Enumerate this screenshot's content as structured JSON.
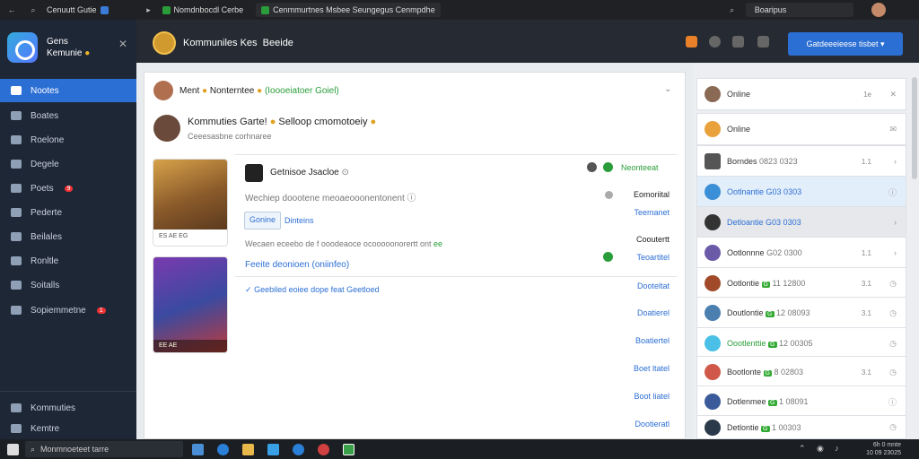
{
  "browser": {
    "tabs": [
      {
        "title": "Cenuutt Gutie"
      },
      {
        "title": "Nomdnbocdl Cerbe"
      },
      {
        "title": "Cenmmurtnes Msbee Seungegus Cenmpdhe"
      }
    ],
    "profile_label": "Boaripus"
  },
  "sidebar": {
    "brand_line1": "Gens",
    "brand_line2": "Kemunie",
    "items": [
      {
        "label": "Nootes",
        "active": true
      },
      {
        "label": "Boates"
      },
      {
        "label": "Roelone"
      },
      {
        "label": "Degele"
      },
      {
        "label": "Poets",
        "badge": "9"
      },
      {
        "label": "Pederte"
      },
      {
        "label": "Beilales"
      },
      {
        "label": "Ronltle"
      },
      {
        "label": "Soitalls"
      },
      {
        "label": "Sopiemmetne",
        "badge": "1"
      }
    ],
    "footer": [
      "Kommuties",
      "Kemtre"
    ]
  },
  "header": {
    "title": "Kommuniles  Kes",
    "title2": "Beeide",
    "action_button": "Gatdeeeieese tisbet"
  },
  "post": {
    "author_line": "Ment",
    "author_tag": "Nonterntee",
    "status_green": "(Ioooeiatoer Goiel)",
    "headline": "Kommuties Garte!",
    "headline2": "Selloop cmomotoeiy",
    "subtext": "Ceeesasbne corhnaree"
  },
  "detail": {
    "name": "Getnisoe Jsacloe",
    "desc": "Wechiep doootene meoaeooonentonent",
    "tab_active": "Gonine",
    "tab_other": "Dinteins",
    "body": "Wecaen eceebo de f ooodeaoce ocooooonorertt ont",
    "body_tag": "ee",
    "link": "Feeite deonioen (oniinfeo)",
    "check_text": "Geebiled eoiee dope feat Geetloed",
    "status_right": "Neonteeat",
    "label1": "Eomoriital",
    "link1": "Teemanet",
    "label2": "Cooutertt",
    "link2": "Teoartitel",
    "links": [
      "Dooteltat",
      "Doatierel",
      "Boatiertel",
      "Boet ltatel",
      "Boot liatel",
      "Dootieratl"
    ],
    "game1_caption": "ES AE EG",
    "game2_caption": "EE AE"
  },
  "panel": {
    "items": [
      {
        "name": "Online",
        "meta": "1e",
        "color": "#8a6a55"
      },
      {
        "name": "Online",
        "meta": "3e",
        "color": "#e9a23b"
      },
      {
        "name": "Borndes",
        "meta2": "0823 0323",
        "meta": "1.1",
        "color": "#555"
      },
      {
        "name": "Ootlnantie",
        "meta2": "G03 0303",
        "meta": "",
        "color": "#3a8fd6",
        "selected": true
      },
      {
        "name": "Detloantie",
        "meta2": "G03 0303",
        "meta": "",
        "color": "#333",
        "dark": true
      },
      {
        "name": "Ootlonnne",
        "meta2": "G02 0300",
        "meta": "1.1",
        "color": "#6a5aa8"
      },
      {
        "name": "Ootlontie",
        "meta2": "11 12800",
        "meta": "3.1",
        "color": "#a04a2a",
        "tag": "G"
      },
      {
        "name": "Doutlontie",
        "meta2": "12 08093",
        "meta": "3.1",
        "color": "#4a7fb0",
        "tag": "G"
      },
      {
        "name": "Oootlenttie",
        "meta2": "12 00305",
        "meta": "",
        "color": "#4ac0e6",
        "tag": "G"
      },
      {
        "name": "Bootlonte",
        "meta2": "8 02803",
        "meta": "3.1",
        "color": "#d0584a",
        "tag": "G"
      },
      {
        "name": "Dotlenmee",
        "meta2": "1 08091",
        "meta": "",
        "color": "#3a5a9a",
        "tag": "G"
      },
      {
        "name": "Detlontie",
        "meta2": "1 00303",
        "meta": "",
        "color": "#2a3a4a",
        "tag": "G"
      }
    ]
  },
  "taskbar": {
    "search_placeholder": "Monmnoeteet tarre",
    "clock_time": "6h 0 mnte",
    "clock_date": "10 09 23025"
  }
}
